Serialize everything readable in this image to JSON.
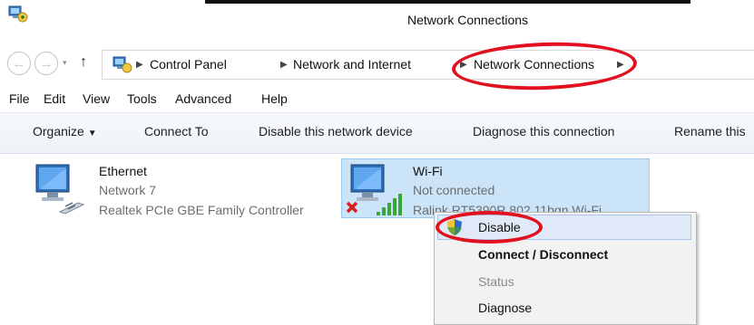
{
  "window": {
    "title": "Network Connections"
  },
  "nav": {
    "back": "←",
    "forward": "→",
    "recent": "▾",
    "up": "↑"
  },
  "breadcrumb": [
    "Control Panel",
    "Network and Internet",
    "Network Connections"
  ],
  "menu": [
    "File",
    "Edit",
    "View",
    "Tools",
    "Advanced",
    "Help"
  ],
  "commands": {
    "organize": "Organize",
    "connect_to": "Connect To",
    "disable_device": "Disable this network device",
    "diagnose": "Diagnose this connection",
    "rename": "Rename this"
  },
  "connections": [
    {
      "name": "Ethernet",
      "network": "Network  7",
      "adapter": "Realtek PCIe GBE Family Controller"
    },
    {
      "name": "Wi-Fi",
      "network": "Not connected",
      "adapter": "Ralink RT5390R 802.11bgn Wi-Fi"
    }
  ],
  "context_menu": {
    "disable": "Disable",
    "connect": "Connect / Disconnect",
    "status": "Status",
    "diagnose": "Diagnose"
  },
  "colors": {
    "selection": "#cce4f7",
    "annotation": "#e2101e"
  }
}
